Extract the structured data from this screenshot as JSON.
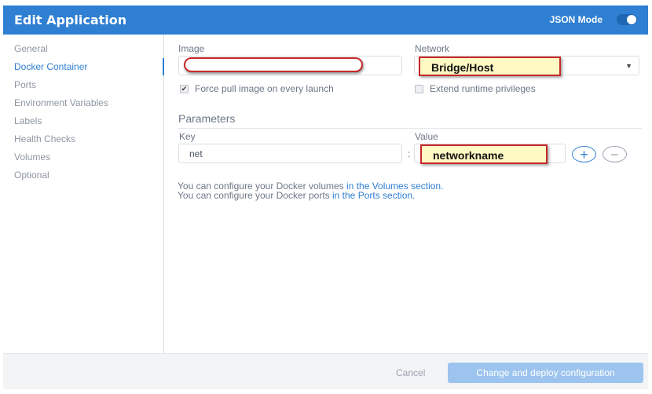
{
  "header": {
    "title": "Edit Application",
    "json_mode_label": "JSON Mode"
  },
  "sidebar": {
    "items": [
      {
        "label": "General"
      },
      {
        "label": "Docker Container",
        "active": true
      },
      {
        "label": "Ports"
      },
      {
        "label": "Environment Variables"
      },
      {
        "label": "Labels"
      },
      {
        "label": "Health Checks"
      },
      {
        "label": "Volumes"
      },
      {
        "label": "Optional"
      }
    ]
  },
  "form": {
    "image_label": "Image",
    "image_value": "",
    "network_label": "Network",
    "network_value": "Bridge/Host",
    "force_pull_label": "Force pull image on every launch",
    "force_pull_checked": true,
    "extend_privileges_label": "Extend runtime privileges",
    "extend_privileges_checked": false
  },
  "parameters": {
    "title": "Parameters",
    "key_label": "Key",
    "value_label": "Value",
    "separator": ":",
    "rows": [
      {
        "key": "net",
        "value": "networkname"
      }
    ]
  },
  "info": {
    "volumes_text": "You can configure your Docker volumes ",
    "volumes_link": "in the Volumes section.",
    "ports_text": "You can configure your Docker ports ",
    "ports_link": "in the Ports section."
  },
  "footer": {
    "cancel_label": "Cancel",
    "deploy_label": "Change and deploy configuration"
  },
  "colors": {
    "accent": "#2f7fd2",
    "annotation_red": "#c62828",
    "annotation_fill": "#fff9c4"
  }
}
